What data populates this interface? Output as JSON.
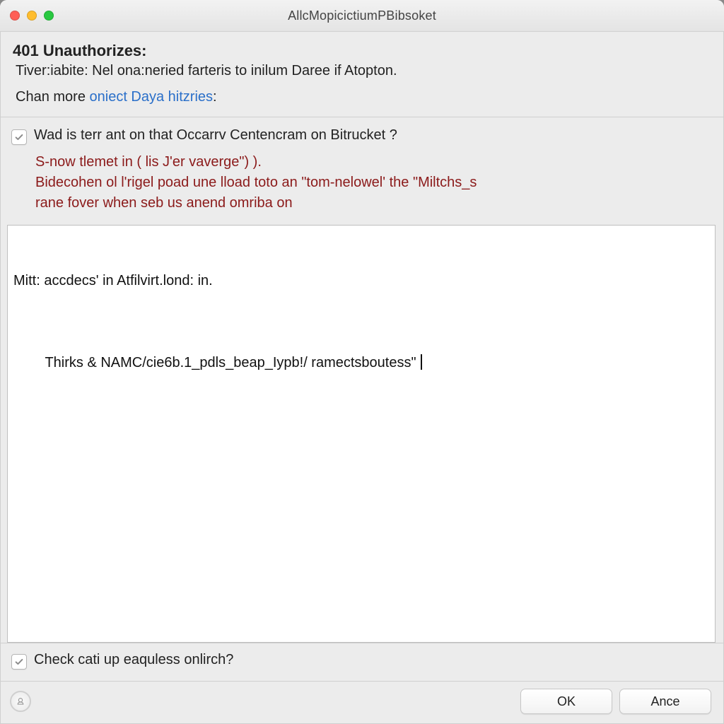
{
  "window": {
    "title": "AllcMopicictiumPBibsoket"
  },
  "header": {
    "heading": "401 Unauthorizes:",
    "subtitle": "Tiver:iabite:  Nel ona:neried farteris to inilum Daree if Atopton.",
    "link_prefix": "Chan more ",
    "link_text": "oniect Daya hitzries",
    "link_suffix": ":"
  },
  "check1": {
    "label": "Wad is terr ant on that Occarrv Centencram on Bitrucket ?",
    "checked": true
  },
  "warning": {
    "line1": "S-now tlemet in ( lis J'er vaverge\") ).",
    "line2": "Bidecohen ol l'rigel poad une lload toto an \"tom-nelowel' the \"Miltchs_s",
    "line3": "rane fover when seb us anend omriba on"
  },
  "textarea": {
    "line1": "Mitt: accdecs' in Atfilvirt.lond: in.",
    "line2": "Thirks & NAMC/cie6b.1_pdls_beap_Iypb!/ ramectsboutess\""
  },
  "check2": {
    "label": "Check cati up eaquless onlirch?",
    "checked": true
  },
  "buttons": {
    "ok": "OK",
    "ance": "Ance"
  }
}
